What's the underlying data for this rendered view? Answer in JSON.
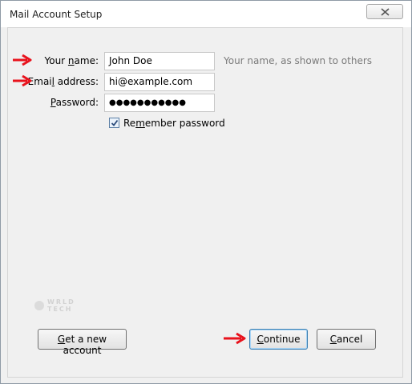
{
  "window": {
    "title": "Mail Account Setup"
  },
  "form": {
    "name_label_pre": "Your ",
    "name_label_key": "n",
    "name_label_post": "ame:",
    "name_value": "John Doe",
    "name_hint": "Your name, as shown to others",
    "email_label_pre": "Emai",
    "email_label_key": "l",
    "email_label_post": " address:",
    "email_value": "hi@example.com",
    "password_label_pre": "",
    "password_label_key": "P",
    "password_label_post": "assword:",
    "password_value": "●●●●●●●●●●●",
    "remember_label_pre": "Re",
    "remember_label_key": "m",
    "remember_label_post": "ember password",
    "remember_checked": true
  },
  "watermark": {
    "line1": "WRLD",
    "line2": "TECH"
  },
  "buttons": {
    "new_account_pre": "",
    "new_account_key": "G",
    "new_account_post": "et a new account",
    "continue_pre": "",
    "continue_key": "C",
    "continue_post": "ontinue",
    "cancel_pre": "",
    "cancel_key": "C",
    "cancel_post": "ancel"
  },
  "colors": {
    "annotation_arrow": "#e8121c",
    "accent": "#3c7fb1"
  }
}
